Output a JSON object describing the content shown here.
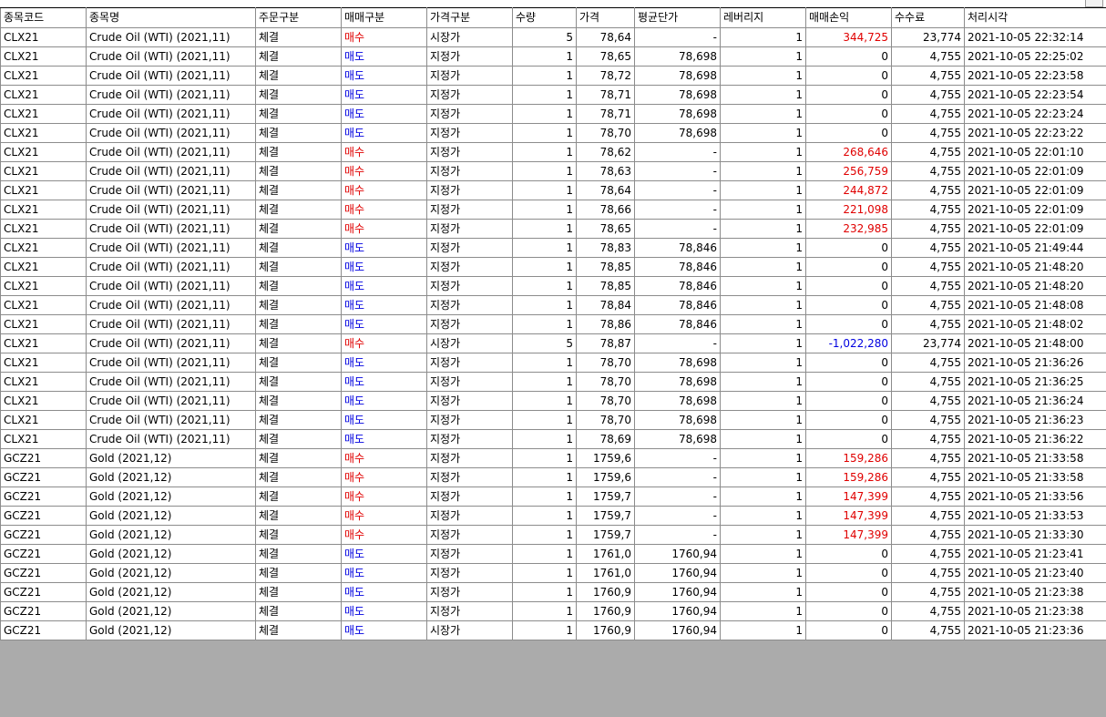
{
  "columns": [
    "종목코드",
    "종목명",
    "주문구분",
    "매매구분",
    "가격구분",
    "수량",
    "가격",
    "평균단가",
    "레버리지",
    "매매손익",
    "수수료",
    "처리시각"
  ],
  "colors": {
    "buy": "#e00000",
    "sell": "#0000e0",
    "profit": "#e00000",
    "loss": "#0000e0"
  },
  "rows": [
    [
      "CLX21",
      "Crude Oil (WTI) (2021,11)",
      "체결",
      "매수",
      "시장가",
      "5",
      "78,64",
      "-",
      "1",
      "344,725",
      "23,774",
      "2021-10-05 22:32:14"
    ],
    [
      "CLX21",
      "Crude Oil (WTI) (2021,11)",
      "체결",
      "매도",
      "지정가",
      "1",
      "78,65",
      "78,698",
      "1",
      "0",
      "4,755",
      "2021-10-05 22:25:02"
    ],
    [
      "CLX21",
      "Crude Oil (WTI) (2021,11)",
      "체결",
      "매도",
      "지정가",
      "1",
      "78,72",
      "78,698",
      "1",
      "0",
      "4,755",
      "2021-10-05 22:23:58"
    ],
    [
      "CLX21",
      "Crude Oil (WTI) (2021,11)",
      "체결",
      "매도",
      "지정가",
      "1",
      "78,71",
      "78,698",
      "1",
      "0",
      "4,755",
      "2021-10-05 22:23:54"
    ],
    [
      "CLX21",
      "Crude Oil (WTI) (2021,11)",
      "체결",
      "매도",
      "지정가",
      "1",
      "78,71",
      "78,698",
      "1",
      "0",
      "4,755",
      "2021-10-05 22:23:24"
    ],
    [
      "CLX21",
      "Crude Oil (WTI) (2021,11)",
      "체결",
      "매도",
      "지정가",
      "1",
      "78,70",
      "78,698",
      "1",
      "0",
      "4,755",
      "2021-10-05 22:23:22"
    ],
    [
      "CLX21",
      "Crude Oil (WTI) (2021,11)",
      "체결",
      "매수",
      "지정가",
      "1",
      "78,62",
      "-",
      "1",
      "268,646",
      "4,755",
      "2021-10-05 22:01:10"
    ],
    [
      "CLX21",
      "Crude Oil (WTI) (2021,11)",
      "체결",
      "매수",
      "지정가",
      "1",
      "78,63",
      "-",
      "1",
      "256,759",
      "4,755",
      "2021-10-05 22:01:09"
    ],
    [
      "CLX21",
      "Crude Oil (WTI) (2021,11)",
      "체결",
      "매수",
      "지정가",
      "1",
      "78,64",
      "-",
      "1",
      "244,872",
      "4,755",
      "2021-10-05 22:01:09"
    ],
    [
      "CLX21",
      "Crude Oil (WTI) (2021,11)",
      "체결",
      "매수",
      "지정가",
      "1",
      "78,66",
      "-",
      "1",
      "221,098",
      "4,755",
      "2021-10-05 22:01:09"
    ],
    [
      "CLX21",
      "Crude Oil (WTI) (2021,11)",
      "체결",
      "매수",
      "지정가",
      "1",
      "78,65",
      "-",
      "1",
      "232,985",
      "4,755",
      "2021-10-05 22:01:09"
    ],
    [
      "CLX21",
      "Crude Oil (WTI) (2021,11)",
      "체결",
      "매도",
      "지정가",
      "1",
      "78,83",
      "78,846",
      "1",
      "0",
      "4,755",
      "2021-10-05 21:49:44"
    ],
    [
      "CLX21",
      "Crude Oil (WTI) (2021,11)",
      "체결",
      "매도",
      "지정가",
      "1",
      "78,85",
      "78,846",
      "1",
      "0",
      "4,755",
      "2021-10-05 21:48:20"
    ],
    [
      "CLX21",
      "Crude Oil (WTI) (2021,11)",
      "체결",
      "매도",
      "지정가",
      "1",
      "78,85",
      "78,846",
      "1",
      "0",
      "4,755",
      "2021-10-05 21:48:20"
    ],
    [
      "CLX21",
      "Crude Oil (WTI) (2021,11)",
      "체결",
      "매도",
      "지정가",
      "1",
      "78,84",
      "78,846",
      "1",
      "0",
      "4,755",
      "2021-10-05 21:48:08"
    ],
    [
      "CLX21",
      "Crude Oil (WTI) (2021,11)",
      "체결",
      "매도",
      "지정가",
      "1",
      "78,86",
      "78,846",
      "1",
      "0",
      "4,755",
      "2021-10-05 21:48:02"
    ],
    [
      "CLX21",
      "Crude Oil (WTI) (2021,11)",
      "체결",
      "매수",
      "시장가",
      "5",
      "78,87",
      "-",
      "1",
      "-1,022,280",
      "23,774",
      "2021-10-05 21:48:00"
    ],
    [
      "CLX21",
      "Crude Oil (WTI) (2021,11)",
      "체결",
      "매도",
      "지정가",
      "1",
      "78,70",
      "78,698",
      "1",
      "0",
      "4,755",
      "2021-10-05 21:36:26"
    ],
    [
      "CLX21",
      "Crude Oil (WTI) (2021,11)",
      "체결",
      "매도",
      "지정가",
      "1",
      "78,70",
      "78,698",
      "1",
      "0",
      "4,755",
      "2021-10-05 21:36:25"
    ],
    [
      "CLX21",
      "Crude Oil (WTI) (2021,11)",
      "체결",
      "매도",
      "지정가",
      "1",
      "78,70",
      "78,698",
      "1",
      "0",
      "4,755",
      "2021-10-05 21:36:24"
    ],
    [
      "CLX21",
      "Crude Oil (WTI) (2021,11)",
      "체결",
      "매도",
      "지정가",
      "1",
      "78,70",
      "78,698",
      "1",
      "0",
      "4,755",
      "2021-10-05 21:36:23"
    ],
    [
      "CLX21",
      "Crude Oil (WTI) (2021,11)",
      "체결",
      "매도",
      "지정가",
      "1",
      "78,69",
      "78,698",
      "1",
      "0",
      "4,755",
      "2021-10-05 21:36:22"
    ],
    [
      "GCZ21",
      "Gold (2021,12)",
      "체결",
      "매수",
      "지정가",
      "1",
      "1759,6",
      "-",
      "1",
      "159,286",
      "4,755",
      "2021-10-05 21:33:58"
    ],
    [
      "GCZ21",
      "Gold (2021,12)",
      "체결",
      "매수",
      "지정가",
      "1",
      "1759,6",
      "-",
      "1",
      "159,286",
      "4,755",
      "2021-10-05 21:33:58"
    ],
    [
      "GCZ21",
      "Gold (2021,12)",
      "체결",
      "매수",
      "지정가",
      "1",
      "1759,7",
      "-",
      "1",
      "147,399",
      "4,755",
      "2021-10-05 21:33:56"
    ],
    [
      "GCZ21",
      "Gold (2021,12)",
      "체결",
      "매수",
      "지정가",
      "1",
      "1759,7",
      "-",
      "1",
      "147,399",
      "4,755",
      "2021-10-05 21:33:53"
    ],
    [
      "GCZ21",
      "Gold (2021,12)",
      "체결",
      "매수",
      "지정가",
      "1",
      "1759,7",
      "-",
      "1",
      "147,399",
      "4,755",
      "2021-10-05 21:33:30"
    ],
    [
      "GCZ21",
      "Gold (2021,12)",
      "체결",
      "매도",
      "지정가",
      "1",
      "1761,0",
      "1760,94",
      "1",
      "0",
      "4,755",
      "2021-10-05 21:23:41"
    ],
    [
      "GCZ21",
      "Gold (2021,12)",
      "체결",
      "매도",
      "지정가",
      "1",
      "1761,0",
      "1760,94",
      "1",
      "0",
      "4,755",
      "2021-10-05 21:23:40"
    ],
    [
      "GCZ21",
      "Gold (2021,12)",
      "체결",
      "매도",
      "지정가",
      "1",
      "1760,9",
      "1760,94",
      "1",
      "0",
      "4,755",
      "2021-10-05 21:23:38"
    ],
    [
      "GCZ21",
      "Gold (2021,12)",
      "체결",
      "매도",
      "지정가",
      "1",
      "1760,9",
      "1760,94",
      "1",
      "0",
      "4,755",
      "2021-10-05 21:23:38"
    ],
    [
      "GCZ21",
      "Gold (2021,12)",
      "체결",
      "매도",
      "시장가",
      "1",
      "1760,9",
      "1760,94",
      "1",
      "0",
      "4,755",
      "2021-10-05 21:23:36"
    ]
  ]
}
